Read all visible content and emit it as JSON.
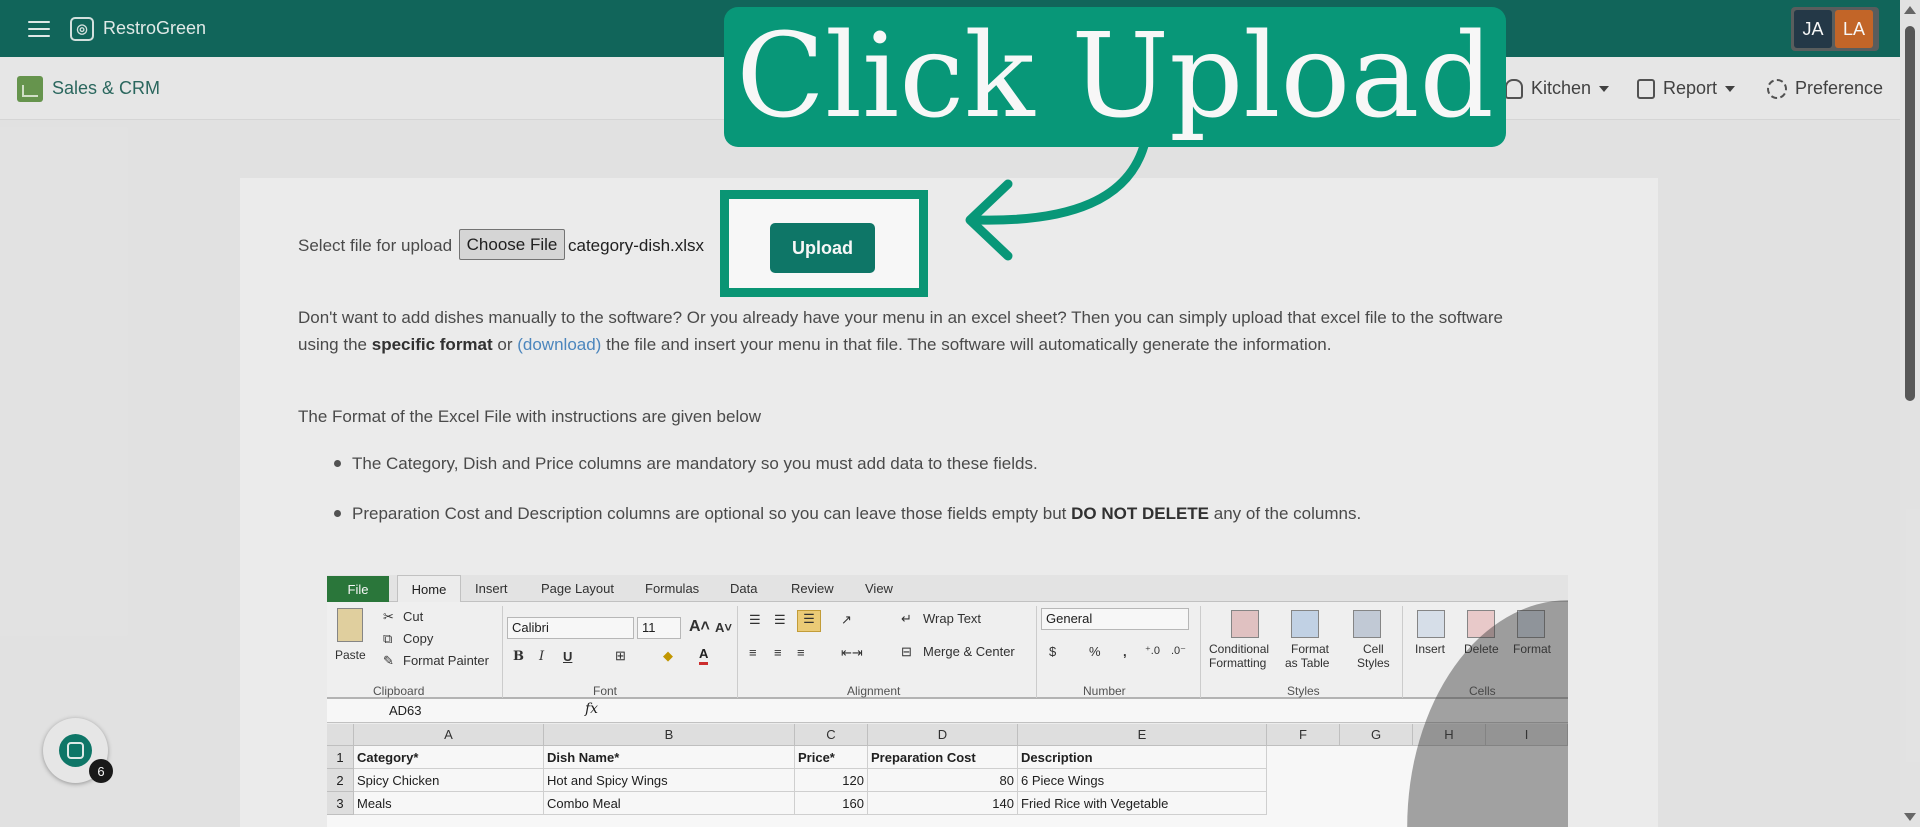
{
  "app": {
    "name": "RestroGreen"
  },
  "users": [
    {
      "initials": "JA"
    },
    {
      "initials": "LA"
    }
  ],
  "module": {
    "label": "Sales & CRM"
  },
  "nav": {
    "kitchen": "Kitchen",
    "report": "Report",
    "preference": "Preference"
  },
  "upload": {
    "select_label": "Select file for upload",
    "choose_file": "Choose File",
    "file_name": "category-dish.xlsx",
    "button": "Upload"
  },
  "callout": {
    "text": "Click Upload"
  },
  "intro": {
    "line1": "Don't want to add dishes manually to the software? Or you already have your menu in an excel sheet? Then you can simply upload that excel file to the software",
    "line2_prefix": "using the ",
    "line2_bold": "specific format",
    "line2_mid": " or ",
    "line2_link": "(download)",
    "line2_suffix": " the file and insert your menu in that file. The software will automatically generate the information."
  },
  "format_heading": "The Format of the Excel File with instructions are given below",
  "instructions": {
    "item1": "The Category, Dish and Price columns are mandatory so you must add data to these fields.",
    "item2_prefix": "Preparation Cost and Description columns are optional so you can leave those fields empty but ",
    "item2_bold": "DO NOT DELETE",
    "item2_suffix": " any of the columns."
  },
  "help": {
    "badge": "6"
  },
  "excel": {
    "tabs": [
      "File",
      "Home",
      "Insert",
      "Page Layout",
      "Formulas",
      "Data",
      "Review",
      "View"
    ],
    "ribbon": {
      "paste": "Paste",
      "cut": "Cut",
      "copy": "Copy",
      "format_painter": "Format Painter",
      "font_name": "Calibri",
      "font_size": "11",
      "wrap_text": "Wrap Text",
      "merge_center": "Merge & Center",
      "number_format": "General",
      "currency": "$",
      "percent": "%",
      "comma": ",",
      "conditional_1": "Conditional",
      "conditional_2": "Formatting",
      "format_table_1": "Format",
      "format_table_2": "as Table",
      "cell_styles_1": "Cell",
      "cell_styles_2": "Styles",
      "insert": "Insert",
      "delete": "Delete",
      "format": "Format",
      "groups": {
        "clipboard": "Clipboard",
        "font": "Font",
        "alignment": "Alignment",
        "number": "Number",
        "styles": "Styles",
        "cells": "Cells"
      }
    },
    "name_box": "AD63",
    "fx": "fx",
    "columns": [
      "A",
      "B",
      "C",
      "D",
      "E",
      "F",
      "G",
      "H",
      "I"
    ],
    "rows": [
      {
        "n": "1",
        "a": "Category*",
        "b": "Dish Name*",
        "c": "Price*",
        "d": "Preparation Cost",
        "e": "Description"
      },
      {
        "n": "2",
        "a": "Spicy Chicken",
        "b": "Hot and Spicy Wings",
        "c": "120",
        "d": "80",
        "e": "6 Piece Wings"
      },
      {
        "n": "3",
        "a": "Meals",
        "b": "Combo Meal",
        "c": "160",
        "d": "140",
        "e": "Fried Rice with Vegetable"
      }
    ]
  },
  "colors": {
    "brand": "#12695d",
    "accent": "#099c7c",
    "button": "#0f7a6b",
    "link": "#4f8bc4"
  }
}
